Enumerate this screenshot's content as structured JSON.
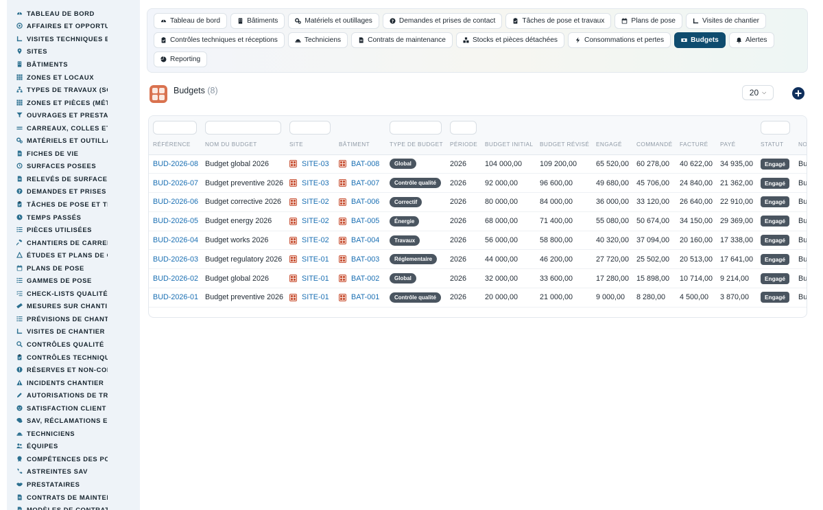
{
  "sidebar": {
    "items": [
      {
        "label": "TABLEAU DE BORD",
        "icon": "dashboard-icon"
      },
      {
        "label": "AFFAIRES ET OPPORTUNITÉS",
        "icon": "target-icon"
      },
      {
        "label": "VISITES TECHNIQUES ET RELEVÉS",
        "icon": "visit-icon"
      },
      {
        "label": "SITES",
        "icon": "map-pin-icon"
      },
      {
        "label": "BÂTIMENTS",
        "icon": "building-icon"
      },
      {
        "label": "ZONES ET LOCAUX",
        "icon": "grid-icon"
      },
      {
        "label": "TYPES DE TRAVAUX (SOLS)",
        "icon": "hierarchy-icon"
      },
      {
        "label": "ZONES ET PIÈCES (MÉTRÉS)",
        "icon": "grid-icon"
      },
      {
        "label": "OUVRAGES ET PRESTATIONS",
        "icon": "funnel-icon"
      },
      {
        "label": "CARREAUX, COLLES ET JOINTS",
        "icon": "lines-icon"
      },
      {
        "label": "MATÉRIELS ET OUTILLAGES",
        "icon": "cogs-icon"
      },
      {
        "label": "FICHES DE VIE",
        "icon": "document-icon"
      },
      {
        "label": "SURFACES POSEES",
        "icon": "history-icon"
      },
      {
        "label": "RELEVÉS DE SURFACES",
        "icon": "document-icon"
      },
      {
        "label": "DEMANDES ET PRISES DE CONTACT",
        "icon": "question-icon"
      },
      {
        "label": "TÂCHES DE POSE ET TRAVAUX",
        "icon": "clipboard-icon"
      },
      {
        "label": "TEMPS PASSÉS",
        "icon": "clock-icon"
      },
      {
        "label": "PIÈCES UTILISÉES",
        "icon": "list-icon"
      },
      {
        "label": "CHANTIERS DE CARRELAGE",
        "icon": "hammer-icon"
      },
      {
        "label": "ÉTUDES ET PLANS DE CALEPINAGE",
        "icon": "drafting-icon"
      },
      {
        "label": "PLANS DE POSE",
        "icon": "calendar-icon"
      },
      {
        "label": "GAMMES DE POSE",
        "icon": "list-icon"
      },
      {
        "label": "CHECK-LISTS QUALITÉ",
        "icon": "checklist-icon"
      },
      {
        "label": "MESURES SUR CHANTIER",
        "icon": "ruler-icon"
      },
      {
        "label": "PRÉVISIONS DE CHANTIER",
        "icon": "list-icon"
      },
      {
        "label": "VISITES DE CHANTIER",
        "icon": "visit-icon"
      },
      {
        "label": "CONTRÔLES QUALITÉ",
        "icon": "search-icon"
      },
      {
        "label": "CONTRÔLES TECHNIQUES",
        "icon": "clipboard-icon"
      },
      {
        "label": "RÉSERVES ET NON-CONFORMITÉS",
        "icon": "alert-circle-icon"
      },
      {
        "label": "INCIDENTS CHANTIER",
        "icon": "warning-icon"
      },
      {
        "label": "AUTORISATIONS DE TRAVAUX",
        "icon": "pen-icon"
      },
      {
        "label": "SATISFACTION CLIENT",
        "icon": "smile-icon"
      },
      {
        "label": "SAV, RÉCLAMATIONS ET GARANTIES",
        "icon": "comments-icon"
      },
      {
        "label": "TECHNICIENS",
        "icon": "hard-hat-icon"
      },
      {
        "label": "ÉQUIPES",
        "icon": "users-icon"
      },
      {
        "label": "COMPÉTENCES DES POSEURS",
        "icon": "award-icon"
      },
      {
        "label": "ASTREINTES SAV",
        "icon": "phone-icon"
      },
      {
        "label": "PRESTATAIRES",
        "icon": "handshake-icon"
      },
      {
        "label": "CONTRATS DE MAINTENANCE",
        "icon": "document-icon"
      },
      {
        "label": "MODÈLES DE CONTRATS",
        "icon": "document-icon"
      }
    ]
  },
  "topnav": {
    "rows": [
      [
        {
          "label": "Tableau de bord",
          "icon": "dashboard-icon",
          "active": false
        },
        {
          "label": "Bâtiments",
          "icon": "building-icon",
          "active": false
        },
        {
          "label": "Matériels et outillages",
          "icon": "cogs-icon",
          "active": false
        },
        {
          "label": "Demandes et prises de contact",
          "icon": "question-icon",
          "active": false
        },
        {
          "label": "Tâches de pose et travaux",
          "icon": "clipboard-icon",
          "active": false
        },
        {
          "label": "Plans de pose",
          "icon": "calendar-icon",
          "active": false
        },
        {
          "label": "Visites de chantier",
          "icon": "visit-icon",
          "active": false
        }
      ],
      [
        {
          "label": "Contrôles techniques et réceptions",
          "icon": "clipboard-icon",
          "active": false
        },
        {
          "label": "Techniciens",
          "icon": "hard-hat-icon",
          "active": false
        },
        {
          "label": "Contrats de maintenance",
          "icon": "document-icon",
          "active": false
        },
        {
          "label": "Stocks et pièces détachées",
          "icon": "boxes-icon",
          "active": false
        },
        {
          "label": "Consommations et pertes",
          "icon": "bolt-icon",
          "active": false
        },
        {
          "label": "Budgets",
          "icon": "money-icon",
          "active": true
        },
        {
          "label": "Alertes",
          "icon": "bell-icon",
          "active": false
        }
      ],
      [
        {
          "label": "Reporting",
          "icon": "chart-pie-icon",
          "active": false
        }
      ]
    ]
  },
  "page": {
    "title": "Budgets",
    "count": "(8)",
    "per_page": "20",
    "add_icon": "plus-circle-icon"
  },
  "table": {
    "columns": [
      "RÉFÉRENCE",
      "NOM DU BUDGET",
      "SITE",
      "BÂTIMENT",
      "TYPE DE BUDGET",
      "PÉRIODE",
      "BUDGET INITIAL",
      "BUDGET RÉVISÉ",
      "ENGAGÉ",
      "COMMANDÉ",
      "FACTURÉ",
      "PAYÉ",
      "STATUT",
      "NOTES"
    ],
    "rows": [
      {
        "ref": "BUD-2026-08",
        "name": "Budget global 2026",
        "site": "SITE-03",
        "batiment": "BAT-008",
        "type": "Global",
        "periode": "2026",
        "initial": "104 000,00",
        "revise": "109 200,00",
        "engage": "65 520,00",
        "commande": "60 278,00",
        "facture": "40 622,00",
        "paye": "34 935,00",
        "statut": "Engagé",
        "notes": "Bu"
      },
      {
        "ref": "BUD-2026-07",
        "name": "Budget preventive 2026",
        "site": "SITE-03",
        "batiment": "BAT-007",
        "type": "Contrôle qualité",
        "periode": "2026",
        "initial": "92 000,00",
        "revise": "96 600,00",
        "engage": "49 680,00",
        "commande": "45 706,00",
        "facture": "24 840,00",
        "paye": "21 362,00",
        "statut": "Engagé",
        "notes": "Bu"
      },
      {
        "ref": "BUD-2026-06",
        "name": "Budget corrective 2026",
        "site": "SITE-02",
        "batiment": "BAT-006",
        "type": "Correctif",
        "periode": "2026",
        "initial": "80 000,00",
        "revise": "84 000,00",
        "engage": "36 000,00",
        "commande": "33 120,00",
        "facture": "26 640,00",
        "paye": "22 910,00",
        "statut": "Engagé",
        "notes": "Bu"
      },
      {
        "ref": "BUD-2026-05",
        "name": "Budget energy 2026",
        "site": "SITE-02",
        "batiment": "BAT-005",
        "type": "Énergie",
        "periode": "2026",
        "initial": "68 000,00",
        "revise": "71 400,00",
        "engage": "55 080,00",
        "commande": "50 674,00",
        "facture": "34 150,00",
        "paye": "29 369,00",
        "statut": "Engagé",
        "notes": "Bu"
      },
      {
        "ref": "BUD-2026-04",
        "name": "Budget works 2026",
        "site": "SITE-02",
        "batiment": "BAT-004",
        "type": "Travaux",
        "periode": "2026",
        "initial": "56 000,00",
        "revise": "58 800,00",
        "engage": "40 320,00",
        "commande": "37 094,00",
        "facture": "20 160,00",
        "paye": "17 338,00",
        "statut": "Engagé",
        "notes": "Bu"
      },
      {
        "ref": "BUD-2026-03",
        "name": "Budget regulatory 2026",
        "site": "SITE-01",
        "batiment": "BAT-003",
        "type": "Réglementaire",
        "periode": "2026",
        "initial": "44 000,00",
        "revise": "46 200,00",
        "engage": "27 720,00",
        "commande": "25 502,00",
        "facture": "20 513,00",
        "paye": "17 641,00",
        "statut": "Engagé",
        "notes": "Bu"
      },
      {
        "ref": "BUD-2026-02",
        "name": "Budget global 2026",
        "site": "SITE-01",
        "batiment": "BAT-002",
        "type": "Global",
        "periode": "2026",
        "initial": "32 000,00",
        "revise": "33 600,00",
        "engage": "17 280,00",
        "commande": "15 898,00",
        "facture": "10 714,00",
        "paye": "9 214,00",
        "statut": "Engagé",
        "notes": "Bu"
      },
      {
        "ref": "BUD-2026-01",
        "name": "Budget preventive 2026",
        "site": "SITE-01",
        "batiment": "BAT-001",
        "type": "Contrôle qualité",
        "periode": "2026",
        "initial": "20 000,00",
        "revise": "21 000,00",
        "engage": "9 000,00",
        "commande": "8 280,00",
        "facture": "4 500,00",
        "paye": "3 870,00",
        "statut": "Engagé",
        "notes": "Bu"
      }
    ]
  },
  "colors": {
    "sidebar_bg": "#eef3f8",
    "accent": "#0f4c6e",
    "link": "#1a6fb3",
    "badge": "#4a5560",
    "brand_icon": "#d9724f"
  }
}
